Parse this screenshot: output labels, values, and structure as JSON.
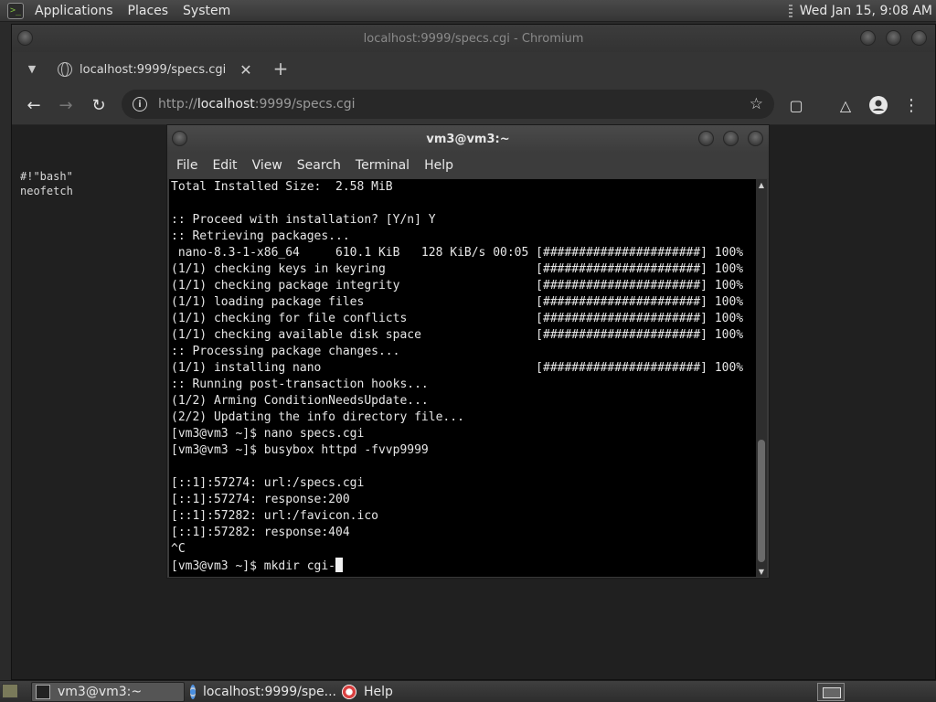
{
  "top_panel": {
    "menus": [
      "Applications",
      "Places",
      "System"
    ],
    "clock": "Wed Jan 15,  9:08 AM"
  },
  "browser": {
    "window_title": "localhost:9999/specs.cgi - Chromium",
    "tab_title": "localhost:9999/specs.cgi",
    "url_scheme": "http://",
    "url_host": "localhost",
    "url_rest": ":9999/specs.cgi",
    "page_text": "#!\"bash\"\nneofetch"
  },
  "terminal": {
    "title": "vm3@vm3:~",
    "menus": [
      "File",
      "Edit",
      "View",
      "Search",
      "Terminal",
      "Help"
    ],
    "lines": [
      "Total Installed Size:  2.58 MiB",
      "",
      ":: Proceed with installation? [Y/n] Y",
      ":: Retrieving packages...",
      " nano-8.3-1-x86_64     610.1 KiB   128 KiB/s 00:05 [######################] 100%",
      "(1/1) checking keys in keyring                     [######################] 100%",
      "(1/1) checking package integrity                   [######################] 100%",
      "(1/1) loading package files                        [######################] 100%",
      "(1/1) checking for file conflicts                  [######################] 100%",
      "(1/1) checking available disk space                [######################] 100%",
      ":: Processing package changes...",
      "(1/1) installing nano                              [######################] 100%",
      ":: Running post-transaction hooks...",
      "(1/2) Arming ConditionNeedsUpdate...",
      "(2/2) Updating the info directory file...",
      "[vm3@vm3 ~]$ nano specs.cgi",
      "[vm3@vm3 ~]$ busybox httpd -fvvp9999",
      "",
      "[::1]:57274: url:/specs.cgi",
      "[::1]:57274: response:200",
      "[::1]:57282: url:/favicon.ico",
      "[::1]:57282: response:404",
      "^C"
    ],
    "prompt_line": "[vm3@vm3 ~]$ mkdir cgi-"
  },
  "taskbar": {
    "items": [
      "vm3@vm3:~",
      "localhost:9999/spe...",
      "Help"
    ]
  }
}
